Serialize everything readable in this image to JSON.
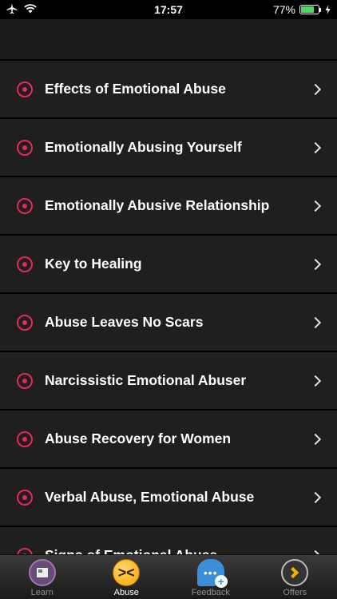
{
  "status": {
    "time": "17:57",
    "battery_percent": "77%",
    "battery_level": 0.77,
    "icons": [
      "airplane-icon",
      "wifi-icon",
      "battery-icon",
      "charging-icon"
    ]
  },
  "accent_color": "#e8265a",
  "list": {
    "items": [
      {
        "label": "Effects of Emotional Abuse"
      },
      {
        "label": "Emotionally Abusing Yourself"
      },
      {
        "label": "Emotionally Abusive Relationship"
      },
      {
        "label": "Key to Healing"
      },
      {
        "label": "Abuse Leaves No Scars"
      },
      {
        "label": "Narcissistic Emotional Abuser"
      },
      {
        "label": "Abuse Recovery for Women"
      },
      {
        "label": "Verbal Abuse, Emotional Abuse"
      },
      {
        "label": "Signs of Emotional Abuse"
      }
    ]
  },
  "tabs": [
    {
      "label": "Learn",
      "icon": "learn-icon"
    },
    {
      "label": "Abuse",
      "icon": "abuse-icon",
      "active": true
    },
    {
      "label": "Feedback",
      "icon": "feedback-icon"
    },
    {
      "label": "Offers",
      "icon": "offers-icon"
    }
  ]
}
